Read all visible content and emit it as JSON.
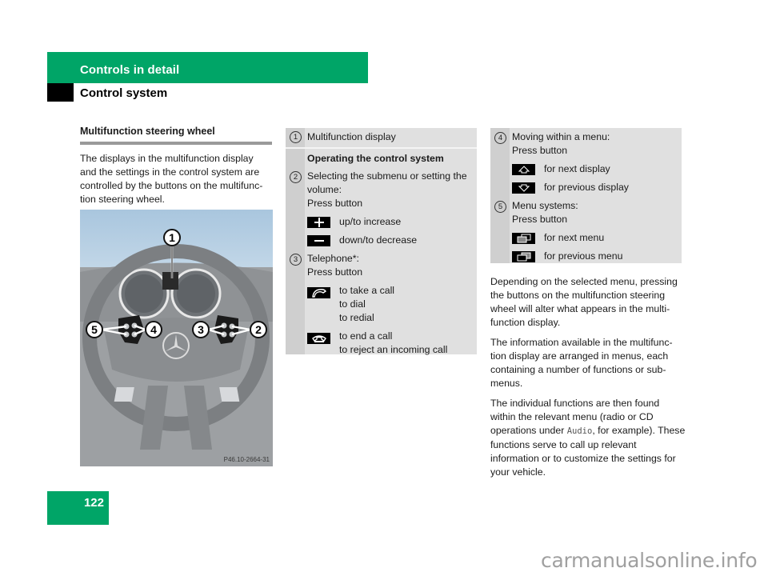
{
  "header": {
    "chapter": "Controls in detail",
    "section": "Control system",
    "accent_color": "#00a567"
  },
  "page_number": "122",
  "left_column": {
    "title": "Multifunction steering wheel",
    "paragraph": "The displays in the multifunction display and the settings in the control system are controlled by the buttons on the multifunc-tion steering wheel."
  },
  "photo": {
    "caption_code": "P46.10-2664-31",
    "callouts": [
      "1",
      "2",
      "3",
      "4",
      "5"
    ]
  },
  "table1": {
    "rows": [
      {
        "num": "1",
        "text": "Multifunction display"
      },
      {
        "heading": "Operating the control system"
      },
      {
        "num": "2",
        "text": "Selecting the submenu or setting the volume:",
        "press": "Press button",
        "buttons": [
          {
            "icon": "plus-icon",
            "label": "up/to increase"
          },
          {
            "icon": "minus-icon",
            "label": "down/to decrease"
          }
        ]
      },
      {
        "num": "3",
        "text": "Telephone*:",
        "press": "Press button",
        "buttons": [
          {
            "icon": "phone-pickup-icon",
            "lines": [
              "to take a call",
              "to dial",
              "to redial"
            ]
          },
          {
            "icon": "phone-hangup-icon",
            "lines": [
              "to end a call",
              "to reject an incoming call"
            ]
          }
        ]
      }
    ]
  },
  "table2": {
    "rows": [
      {
        "num": "4",
        "text": "Moving within a menu:",
        "press": "Press button",
        "buttons": [
          {
            "icon": "arrow-up-icon",
            "label": "for next display"
          },
          {
            "icon": "arrow-down-icon",
            "label": "for previous display"
          }
        ]
      },
      {
        "num": "5",
        "text": "Menu systems:",
        "press": "Press button",
        "buttons": [
          {
            "icon": "next-menu-icon",
            "label": "for next menu"
          },
          {
            "icon": "previous-menu-icon",
            "label": "for previous menu"
          }
        ]
      }
    ]
  },
  "right_column": {
    "p1": "Depending on the selected menu, pressing the buttons on the multifunction steering wheel will alter what appears in the multi-function display.",
    "p2": "The information available in the multifunc-tion display are arranged in menus, each containing a number of functions or sub-menus.",
    "p3_before": "The individual functions are then found within the relevant menu (radio or CD operations under ",
    "p3_code": "Audio",
    "p3_after": ", for example). These functions serve to call up relevant information or to customize the settings for your vehicle."
  },
  "watermark": "carmanualsonline.info"
}
